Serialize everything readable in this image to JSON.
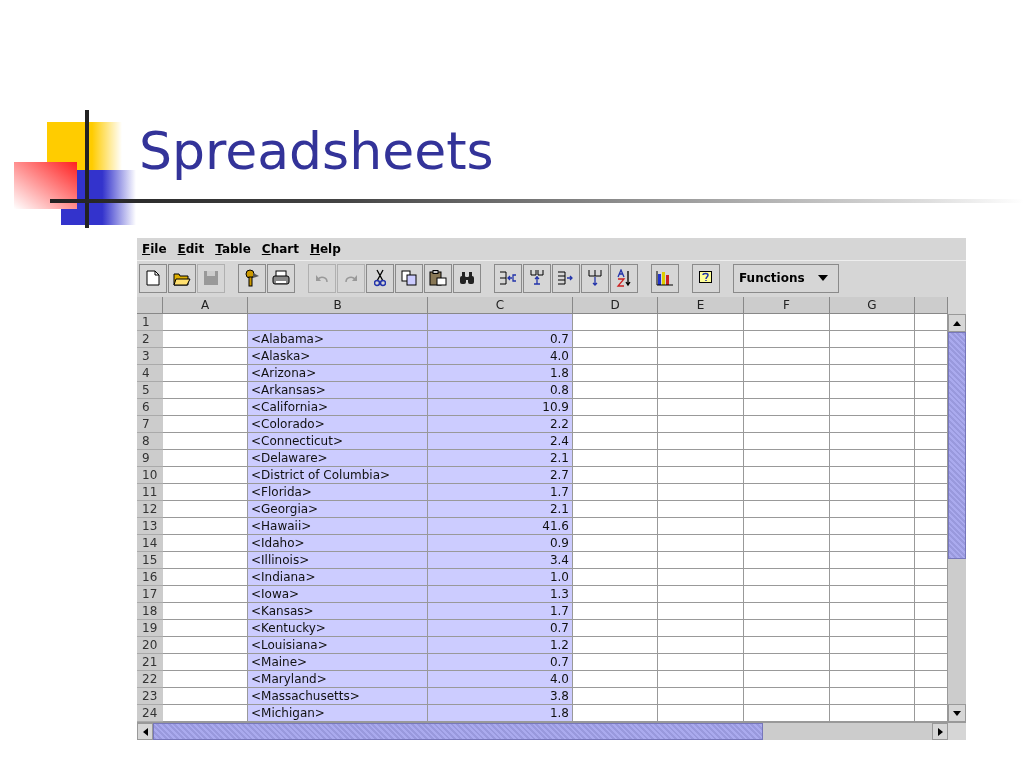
{
  "slide": {
    "title": "Spreadsheets"
  },
  "menu": [
    {
      "label": "File"
    },
    {
      "label": "Edit"
    },
    {
      "label": "Table"
    },
    {
      "label": "Chart"
    },
    {
      "label": "Help"
    }
  ],
  "toolbar": [
    {
      "buttons": [
        {
          "kind": "new",
          "disabled": false
        },
        {
          "kind": "open",
          "disabled": false
        },
        {
          "kind": "save",
          "disabled": true
        }
      ]
    },
    {
      "buttons": [
        {
          "kind": "keys",
          "disabled": false
        },
        {
          "kind": "print",
          "disabled": false
        }
      ]
    },
    {
      "buttons": [
        {
          "kind": "undo",
          "disabled": true
        },
        {
          "kind": "redo",
          "disabled": true
        },
        {
          "kind": "cut",
          "disabled": false
        },
        {
          "kind": "copy",
          "disabled": false
        },
        {
          "kind": "paste",
          "disabled": false
        },
        {
          "kind": "find",
          "disabled": false
        }
      ]
    },
    {
      "buttons": [
        {
          "kind": "insert-column",
          "disabled": false
        },
        {
          "kind": "insert-row",
          "disabled": false
        },
        {
          "kind": "append-column",
          "disabled": false
        },
        {
          "kind": "append-row",
          "disabled": false
        },
        {
          "kind": "sort",
          "disabled": false
        }
      ]
    },
    {
      "buttons": [
        {
          "kind": "chart",
          "disabled": false
        }
      ]
    },
    {
      "buttons": [
        {
          "kind": "help",
          "disabled": false
        }
      ]
    }
  ],
  "functions_dropdown": {
    "label": "Functions"
  },
  "columns": [
    {
      "label": "A",
      "selected": false
    },
    {
      "label": "B",
      "selected": true
    },
    {
      "label": "C",
      "selected": true
    },
    {
      "label": "D",
      "selected": false
    },
    {
      "label": "E",
      "selected": false
    },
    {
      "label": "F",
      "selected": false
    },
    {
      "label": "G",
      "selected": false
    }
  ],
  "rows": [
    {
      "number": "1"
    },
    {
      "number": "2",
      "b": "<Alabama>",
      "c": "0.7"
    },
    {
      "number": "3",
      "b": "<Alaska>",
      "c": "4.0"
    },
    {
      "number": "4",
      "b": "<Arizona>",
      "c": "1.8"
    },
    {
      "number": "5",
      "b": "<Arkansas>",
      "c": "0.8"
    },
    {
      "number": "6",
      "b": "<California>",
      "c": "10.9"
    },
    {
      "number": "7",
      "b": "<Colorado>",
      "c": "2.2"
    },
    {
      "number": "8",
      "b": "<Connecticut>",
      "c": "2.4"
    },
    {
      "number": "9",
      "b": "<Delaware>",
      "c": "2.1"
    },
    {
      "number": "10",
      "b": "<District of Columbia>",
      "c": "2.7"
    },
    {
      "number": "11",
      "b": "<Florida>",
      "c": "1.7"
    },
    {
      "number": "12",
      "b": "<Georgia>",
      "c": "2.1"
    },
    {
      "number": "13",
      "b": "<Hawaii>",
      "c": "41.6"
    },
    {
      "number": "14",
      "b": "<Idaho>",
      "c": "0.9"
    },
    {
      "number": "15",
      "b": "<Illinois>",
      "c": "3.4"
    },
    {
      "number": "16",
      "b": "<Indiana>",
      "c": "1.0"
    },
    {
      "number": "17",
      "b": "<Iowa>",
      "c": "1.3"
    },
    {
      "number": "18",
      "b": "<Kansas>",
      "c": "1.7"
    },
    {
      "number": "19",
      "b": "<Kentucky>",
      "c": "0.7"
    },
    {
      "number": "20",
      "b": "<Louisiana>",
      "c": "1.2"
    },
    {
      "number": "21",
      "b": "<Maine>",
      "c": "0.7"
    },
    {
      "number": "22",
      "b": "<Maryland>",
      "c": "4.0"
    },
    {
      "number": "23",
      "b": "<Massachusetts>",
      "c": "3.8"
    },
    {
      "number": "24",
      "b": "<Michigan>",
      "c": "1.8"
    }
  ]
}
